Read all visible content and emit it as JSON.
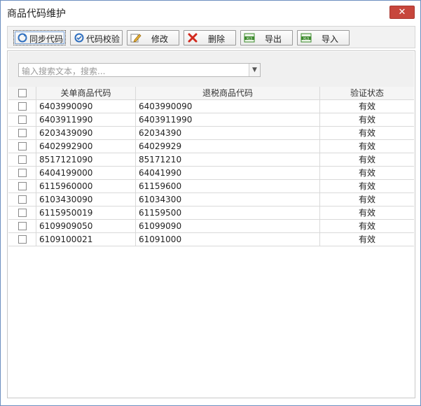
{
  "window": {
    "title": "商品代码维护",
    "close_label": "✕"
  },
  "toolbar": {
    "buttons": [
      {
        "label": "同步代码",
        "icon": "sync-icon"
      },
      {
        "label": "代码校验",
        "icon": "verify-icon"
      },
      {
        "label": "修改",
        "icon": "edit-icon"
      },
      {
        "label": "删除",
        "icon": "delete-icon"
      },
      {
        "label": "导出",
        "icon": "xls-export-icon"
      },
      {
        "label": "导入",
        "icon": "xls-import-icon"
      }
    ]
  },
  "search": {
    "placeholder": "输入搜索文本，搜索..."
  },
  "table": {
    "columns": [
      "关单商品代码",
      "退税商品代码",
      "验证状态"
    ],
    "rows": [
      {
        "customs_code": "6403990090",
        "refund_code": "6403990090",
        "status": "有效"
      },
      {
        "customs_code": "6403911990",
        "refund_code": "6403911990",
        "status": "有效"
      },
      {
        "customs_code": "6203439090",
        "refund_code": "62034390",
        "status": "有效"
      },
      {
        "customs_code": "6402992900",
        "refund_code": "64029929",
        "status": "有效"
      },
      {
        "customs_code": "8517121090",
        "refund_code": "85171210",
        "status": "有效"
      },
      {
        "customs_code": "6404199000",
        "refund_code": "64041990",
        "status": "有效"
      },
      {
        "customs_code": "6115960000",
        "refund_code": "61159600",
        "status": "有效"
      },
      {
        "customs_code": "6103430090",
        "refund_code": "61034300",
        "status": "有效"
      },
      {
        "customs_code": "6115950019",
        "refund_code": "61159500",
        "status": "有效"
      },
      {
        "customs_code": "6109909050",
        "refund_code": "61099090",
        "status": "有效"
      },
      {
        "customs_code": "6109100021",
        "refund_code": "61091000",
        "status": "有效"
      }
    ]
  }
}
